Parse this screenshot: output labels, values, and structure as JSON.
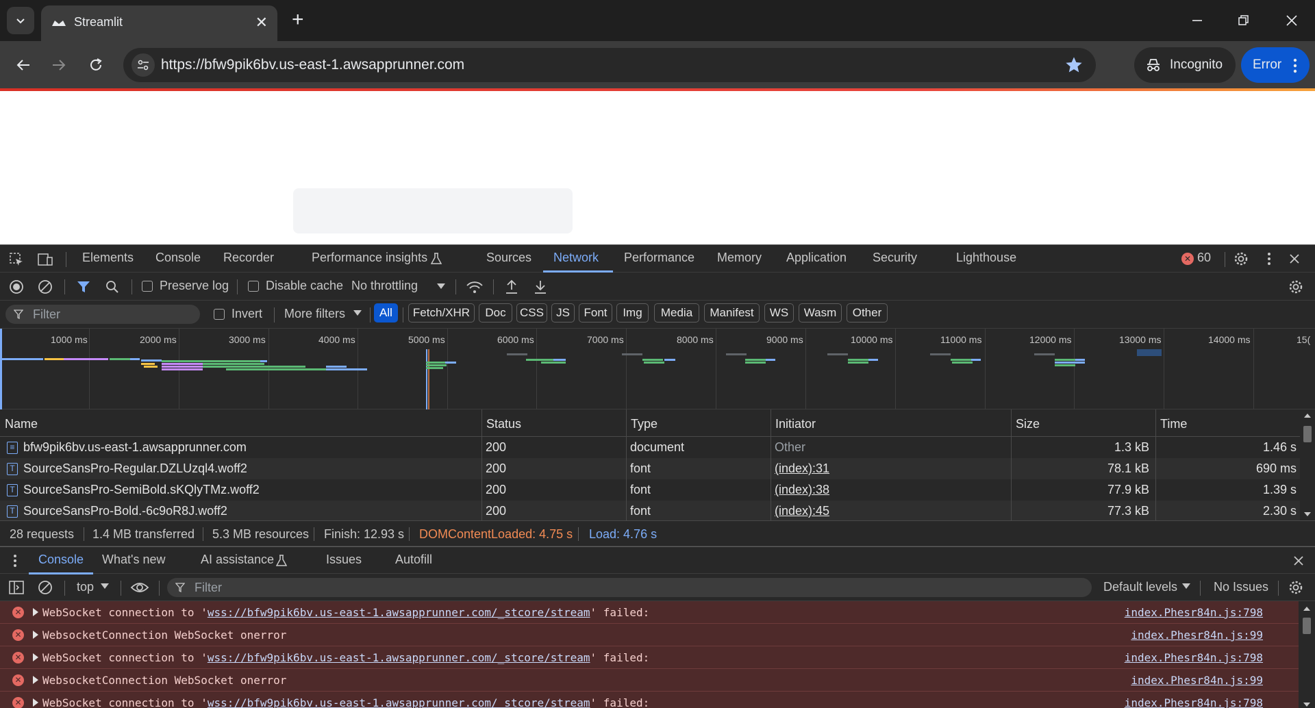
{
  "browser": {
    "tab_title": "Streamlit",
    "url": "https://bfw9pik6bv.us-east-1.awsapprunner.com",
    "incognito_label": "Incognito",
    "error_label": "Error"
  },
  "devtools": {
    "main_tabs": [
      "Elements",
      "Console",
      "Recorder",
      "Performance insights",
      "Sources",
      "Network",
      "Performance",
      "Memory",
      "Application",
      "Security",
      "Lighthouse"
    ],
    "active_tab": "Network",
    "error_count": "60",
    "network_toolbar": {
      "preserve_log": "Preserve log",
      "disable_cache": "Disable cache",
      "throttling": "No throttling"
    },
    "filter_bar": {
      "placeholder": "Filter",
      "invert": "Invert",
      "more_filters": "More filters",
      "type_filters": [
        "All",
        "Fetch/XHR",
        "Doc",
        "CSS",
        "JS",
        "Font",
        "Img",
        "Media",
        "Manifest",
        "WS",
        "Wasm",
        "Other"
      ],
      "active_filter": "All"
    },
    "overview_ticks": [
      "1000 ms",
      "2000 ms",
      "3000 ms",
      "4000 ms",
      "5000 ms",
      "6000 ms",
      "7000 ms",
      "8000 ms",
      "9000 ms",
      "10000 ms",
      "11000 ms",
      "12000 ms",
      "13000 ms",
      "14000 ms",
      "15("
    ],
    "table": {
      "headers": [
        "Name",
        "Status",
        "Type",
        "Initiator",
        "Size",
        "Time"
      ],
      "rows": [
        {
          "name": "bfw9pik6bv.us-east-1.awsapprunner.com",
          "status": "200",
          "type": "document",
          "initiator": "Other",
          "size": "1.3 kB",
          "time": "1.46 s",
          "icon": "document-icon"
        },
        {
          "name": "SourceSansPro-Regular.DZLUzql4.woff2",
          "status": "200",
          "type": "font",
          "initiator": "(index):31",
          "size": "78.1 kB",
          "time": "690 ms",
          "icon": "font-icon"
        },
        {
          "name": "SourceSansPro-SemiBold.sKQlyTMz.woff2",
          "status": "200",
          "type": "font",
          "initiator": "(index):38",
          "size": "77.9 kB",
          "time": "1.39 s",
          "icon": "font-icon"
        },
        {
          "name": "SourceSansPro-Bold.-6c9oR8J.woff2",
          "status": "200",
          "type": "font",
          "initiator": "(index):45",
          "size": "77.3 kB",
          "time": "2.30 s",
          "icon": "font-icon"
        }
      ]
    },
    "summary": {
      "requests": "28 requests",
      "transferred": "1.4 MB transferred",
      "resources": "5.3 MB resources",
      "finish": "Finish: 12.93 s",
      "dom_content_loaded": "DOMContentLoaded: 4.75 s",
      "load": "Load: 4.76 s",
      "dcl_color": "#f28b54",
      "load_color": "#7cacf8"
    },
    "drawer": {
      "tabs": [
        "Console",
        "What's new",
        "AI assistance",
        "Issues",
        "Autofill"
      ],
      "active_tab": "Console",
      "context": "top",
      "filter_placeholder": "Filter",
      "levels": "Default levels",
      "issues": "No Issues"
    },
    "console_messages": [
      {
        "text_before": "WebSocket connection to '",
        "link": "wss://bfw9pik6bv.us-east-1.awsapprunner.com/_stcore/stream",
        "text_after": "' failed:",
        "source": "index.Phesr84n.js:798"
      },
      {
        "text_before": "WebsocketConnection WebSocket onerror",
        "link": "",
        "text_after": "",
        "source": "index.Phesr84n.js:99"
      },
      {
        "text_before": "WebSocket connection to '",
        "link": "wss://bfw9pik6bv.us-east-1.awsapprunner.com/_stcore/stream",
        "text_after": "' failed:",
        "source": "index.Phesr84n.js:798"
      },
      {
        "text_before": "WebsocketConnection WebSocket onerror",
        "link": "",
        "text_after": "",
        "source": "index.Phesr84n.js:99"
      },
      {
        "text_before": "WebSocket connection to '",
        "link": "wss://bfw9pik6bv.us-east-1.awsapprunner.com/_stcore/stream",
        "text_after": "' failed:",
        "source": "index.Phesr84n.js:798"
      }
    ]
  }
}
